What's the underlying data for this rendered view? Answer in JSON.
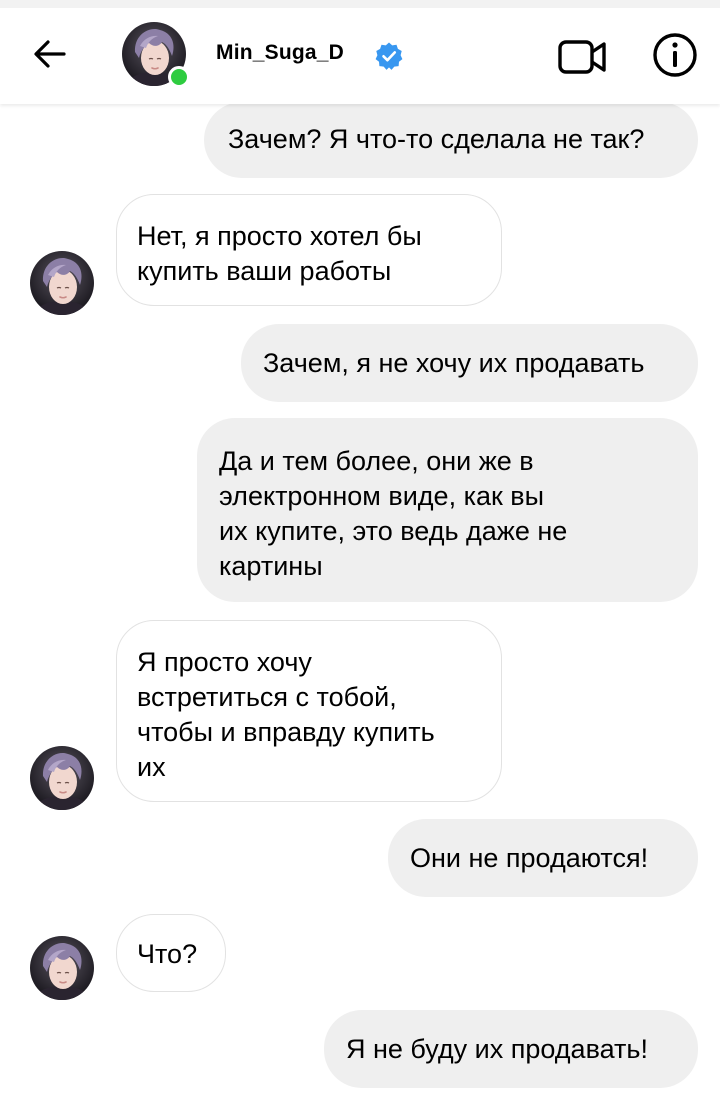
{
  "header": {
    "username": "Min_Suga_D",
    "verified": true,
    "online": true,
    "icons": {
      "back": "back-arrow-icon",
      "video": "video-call-icon",
      "info": "info-icon",
      "verified": "verified-badge-icon"
    }
  },
  "colors": {
    "outgoing_bubble": "#efefef",
    "incoming_border": "#e2e2e2",
    "verified": "#3897f0",
    "online": "#2ecc40"
  },
  "messages": [
    {
      "direction": "out",
      "text": "Зачем? Я что-то сделала не так?"
    },
    {
      "direction": "in",
      "text": "Нет, я просто хотел бы\nкупить ваши работы"
    },
    {
      "direction": "out",
      "text": "Зачем, я не хочу их продавать"
    },
    {
      "direction": "out",
      "text": "Да и тем более, они же в\nэлектронном виде, как вы\nих купите, это ведь даже не\nкартины"
    },
    {
      "direction": "in",
      "text": "Я просто хочу\nвстретиться с тобой,\nчтобы и вправду купить\nих"
    },
    {
      "direction": "out",
      "text": "Они не продаются!"
    },
    {
      "direction": "in",
      "text": "Что?"
    },
    {
      "direction": "out",
      "text": "Я не буду их продавать!"
    }
  ]
}
